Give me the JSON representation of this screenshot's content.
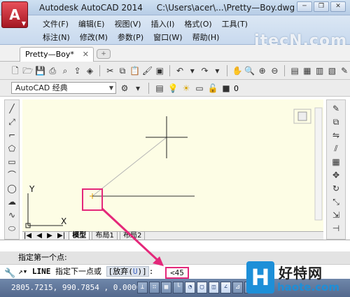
{
  "window": {
    "app_logo_letter": "A",
    "app_name": "Autodesk AutoCAD 2014",
    "file_path": "C:\\Users\\acer\\...\\Pretty—Boy.dwg",
    "controls": [
      "─",
      "❐",
      "✕"
    ]
  },
  "menubar": {
    "row1": [
      "文件(F)",
      "编辑(E)",
      "视图(V)",
      "插入(I)",
      "格式(O)",
      "工具(T)"
    ],
    "row2": [
      "标注(N)",
      "修改(M)",
      "参数(P)",
      "窗口(W)",
      "帮助(H)"
    ],
    "watermark": "itecN.com"
  },
  "doc_tabs": {
    "active": "Pretty—Boy*",
    "close": "✕",
    "new": "+"
  },
  "toolbar": {
    "workspace": "AutoCAD 经典",
    "layer_value": "0"
  },
  "canvas": {
    "ucs_y": "Y",
    "ucs_x": "X",
    "layout_tabs": [
      "模型",
      "布局1",
      "布局2"
    ],
    "nav_arrows": [
      "|◀",
      "◀",
      "▶",
      "▶|"
    ]
  },
  "command": {
    "history": "指定第一个点:",
    "prompt_keyword": "LINE",
    "prompt_text": "指定下一点或",
    "option_label": "放弃",
    "option_key": "U",
    "input_value": "<45"
  },
  "statusbar": {
    "coordinates": "2805.7215, 990.7854 , 0.0000"
  },
  "watermark_logo": {
    "mark": "H",
    "name": "好特网",
    "url": "haote.com"
  },
  "colors": {
    "highlight": "#e4287a",
    "canvas_bg": "#fdfde5",
    "status_bg": "#5f769a"
  }
}
